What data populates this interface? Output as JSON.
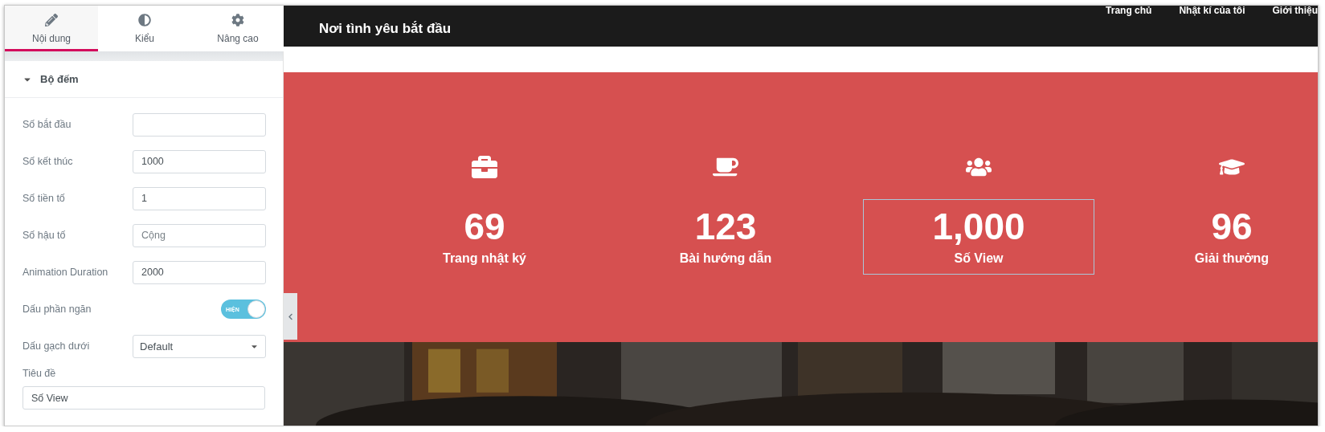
{
  "panel": {
    "tabs": [
      {
        "label": "Nội dung",
        "selected": true
      },
      {
        "label": "Kiểu",
        "selected": false
      },
      {
        "label": "Nâng cao",
        "selected": false
      }
    ],
    "section": {
      "title": "Bộ đếm",
      "expanded": true
    },
    "fields": [
      {
        "kind": "text",
        "label": "Số bắt đầu"
      },
      {
        "kind": "text",
        "label": "Số kết thúc",
        "value": "1000"
      },
      {
        "kind": "text",
        "label": "Số tiền tố",
        "value": "1"
      },
      {
        "kind": "text",
        "label": "Số hậu tố",
        "placeholder": "Cộng"
      },
      {
        "kind": "text",
        "label": "Animation Duration",
        "value": "2000"
      },
      {
        "kind": "toggle",
        "label": "Dấu phần ngăn",
        "on": true,
        "on_text": "HIỆN"
      },
      {
        "kind": "select",
        "label": "Dấu gạch dưới",
        "value": "Default"
      },
      {
        "kind": "stacked",
        "label": "Tiêu đề",
        "value": "Số View"
      }
    ]
  },
  "page": {
    "brand": "Nơi tình yêu bắt đầu",
    "nav": [
      "Trang chủ",
      "Nhật kí của tôi",
      "Giới thiệu"
    ],
    "stats": [
      {
        "number": "69",
        "label": "Trang nhật ký",
        "selected": false
      },
      {
        "number": "123",
        "label": "Bài hướng dẫn",
        "selected": false
      },
      {
        "number": "1,000",
        "label": "Số View",
        "selected": true
      },
      {
        "number": "96",
        "label": "Giải thưởng",
        "selected": false
      }
    ],
    "photo": {
      "kind": "picture"
    }
  }
}
